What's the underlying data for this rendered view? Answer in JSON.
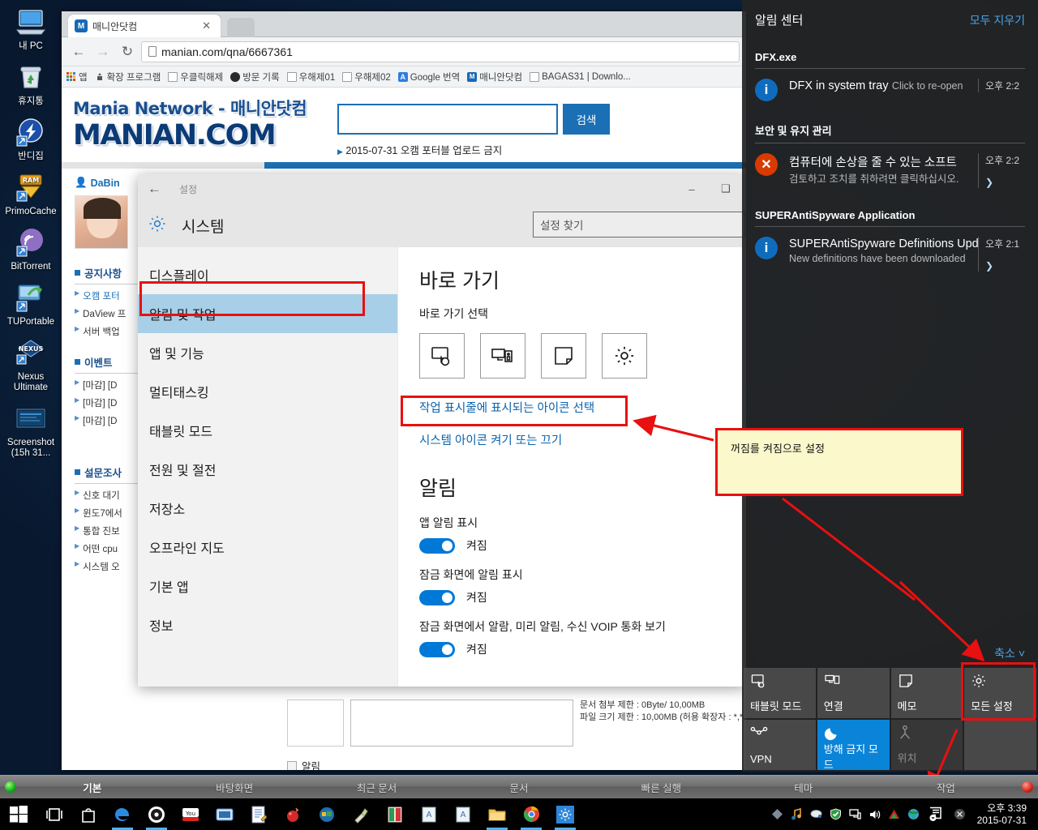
{
  "desktop": {
    "icons": [
      {
        "label": "내 PC",
        "icon": "computer-icon"
      },
      {
        "label": "휴지통",
        "icon": "recycle-bin-icon"
      },
      {
        "label": "반디집",
        "icon": "bandizip-icon"
      },
      {
        "label": "PrimoCache",
        "icon": "primocache-icon"
      },
      {
        "label": "BitTorrent",
        "icon": "bittorrent-icon"
      },
      {
        "label": "TUPortable",
        "icon": "tuportable-icon"
      },
      {
        "label": "Nexus Ultimate",
        "icon": "nexus-ultimate-icon"
      },
      {
        "label": "Screenshot (15h 31...",
        "icon": "screenshot-folder-icon"
      }
    ]
  },
  "browser": {
    "tab": {
      "title": "매니안닷컴",
      "favicon_letter": "M",
      "close": "✕"
    },
    "nav": {
      "back": "←",
      "forward": "→",
      "reload": "↻"
    },
    "address": "manian.com/qna/6667361",
    "bookmarks": [
      {
        "label": "앱",
        "icon": "apps-grid-icon"
      },
      {
        "label": "확장 프로그램",
        "icon": "extensions-icon"
      },
      {
        "label": "우클릭해제",
        "icon": "page-icon"
      },
      {
        "label": "방문 기록",
        "icon": "history-icon"
      },
      {
        "label": "우해제01",
        "icon": "page-icon"
      },
      {
        "label": "우해제02",
        "icon": "page-icon"
      },
      {
        "label": "Google 번역",
        "icon": "translate-icon"
      },
      {
        "label": "매니안닷컴",
        "icon": "manian-icon"
      },
      {
        "label": "BAGAS31 | Downlo...",
        "icon": "page-icon"
      }
    ]
  },
  "site": {
    "logo_top": "Mania Network - 매니안닷컴",
    "logo_main": "MANIAN.COM",
    "search_value": "",
    "search_button": "검색",
    "notice": "2015-07-31 오캠 포터블 업로드 금지",
    "user": "DaBin",
    "sections": [
      {
        "title": "공지사항",
        "items": [
          "오캠 포터",
          "DaView 프",
          "서버 백업"
        ]
      },
      {
        "title": "이벤트",
        "items": [
          "[마감] [D",
          "[마감] [D",
          "[마감] [D"
        ]
      },
      {
        "title": "설문조사",
        "items": [
          "신호 대기",
          "윈도7에서",
          "통합 진보",
          "어떤 cpu",
          "시스템 오"
        ]
      }
    ],
    "upload_limit_doc": "문서 첨부 제한 : 0Byte/ 10,00MB",
    "upload_limit_file": "파일 크기 제한 : 10,00MB (허용 확장자 : *,*",
    "checkbox_label": "알림"
  },
  "settings": {
    "window_title": "설정",
    "back": "←",
    "minimize": "–",
    "maximize": "❑",
    "header": "시스템",
    "search_placeholder": "설정 찾기",
    "nav": [
      {
        "label": "디스플레이",
        "selected": false
      },
      {
        "label": "알림 및 작업",
        "selected": true
      },
      {
        "label": "앱 및 기능",
        "selected": false
      },
      {
        "label": "멀티태스킹",
        "selected": false
      },
      {
        "label": "태블릿 모드",
        "selected": false
      },
      {
        "label": "전원 및 절전",
        "selected": false
      },
      {
        "label": "저장소",
        "selected": false
      },
      {
        "label": "오프라인 지도",
        "selected": false
      },
      {
        "label": "기본 앱",
        "selected": false
      },
      {
        "label": "정보",
        "selected": false
      }
    ],
    "quick_heading": "바로 가기",
    "quick_sub": "바로 가기 선택",
    "quick_tiles": [
      "tablet-mode-icon",
      "connect-icon",
      "note-icon",
      "gear-icon"
    ],
    "link_taskbar_icons": "작업 표시줄에 표시되는 아이콘 선택",
    "link_system_icons": "시스템 아이콘 켜기 또는 끄기",
    "notify_heading": "알림",
    "options": [
      {
        "label": "앱 알림 표시",
        "state": "켜짐"
      },
      {
        "label": "잠금 화면에 알림 표시",
        "state": "켜짐"
      },
      {
        "label": "잠금 화면에서 알람, 미리 알림, 수신 VOIP 통화 보기",
        "state": "켜짐"
      }
    ]
  },
  "action_center": {
    "title": "알림 센터",
    "clear_all": "모두 지우기",
    "groups": [
      {
        "name": "DFX.exe",
        "items": [
          {
            "title": "DFX in system tray",
            "body": "Click to re-open",
            "time": "오후 2:2",
            "icon": "info-icon",
            "chevron": false
          }
        ]
      },
      {
        "name": "보안 및 유지 관리",
        "items": [
          {
            "title": "컴퓨터에 손상을 줄 수 있는 소프트",
            "body": "검토하고 조치를 취하려면 클릭하십시오.",
            "time": "오후 2:2",
            "icon": "error-icon",
            "chevron": true
          }
        ]
      },
      {
        "name": "SUPERAntiSpyware Application",
        "items": [
          {
            "title": "SUPERAntiSpyware Definitions Upd",
            "body": "New definitions have been downloaded",
            "time": "오후 2:1",
            "icon": "info-icon",
            "chevron": true
          }
        ]
      }
    ],
    "collapse": "축소",
    "quick_actions": [
      {
        "label": "태블릿 모드",
        "icon": "tablet-mode-icon",
        "state": "normal"
      },
      {
        "label": "연결",
        "icon": "connect-icon",
        "state": "normal"
      },
      {
        "label": "메모",
        "icon": "note-icon",
        "state": "normal"
      },
      {
        "label": "모든 설정",
        "icon": "gear-icon",
        "state": "normal"
      },
      {
        "label": "VPN",
        "icon": "vpn-icon",
        "state": "normal"
      },
      {
        "label": "방해 금지 모드",
        "icon": "moon-icon",
        "state": "on"
      },
      {
        "label": "위치",
        "icon": "location-icon",
        "state": "off"
      }
    ]
  },
  "annotation": {
    "callout_text": "꺼짐를 켜짐으로 설정",
    "highlight_color": "#e81010"
  },
  "taskbar": {
    "toolbar_items": [
      "기본",
      "바탕화면",
      "최근 문서",
      "문서",
      "빠른 실행",
      "테마",
      "작업"
    ],
    "active_toolbar_item": "기본",
    "pinned": [
      "task-view-icon",
      "store-icon",
      "edge-icon",
      "daum-pot-icon",
      "youtube-icon",
      "media-icon",
      "notepad-icon",
      "red-app-icon",
      "windows-app-icon",
      "cleaner-icon",
      "pdf-icon",
      "dictionary-icon",
      "dictionary2-icon",
      "explorer-icon",
      "chrome-icon",
      "settings-icon"
    ],
    "tray": [
      "diamond-icon",
      "music-icon",
      "mouse-icon",
      "shield-icon",
      "network-icon",
      "volume-icon",
      "autocad-icon",
      "globe-icon"
    ],
    "action_center_icon": "action-center-icon",
    "time": "오후 3:39",
    "date": "2015-07-31"
  }
}
